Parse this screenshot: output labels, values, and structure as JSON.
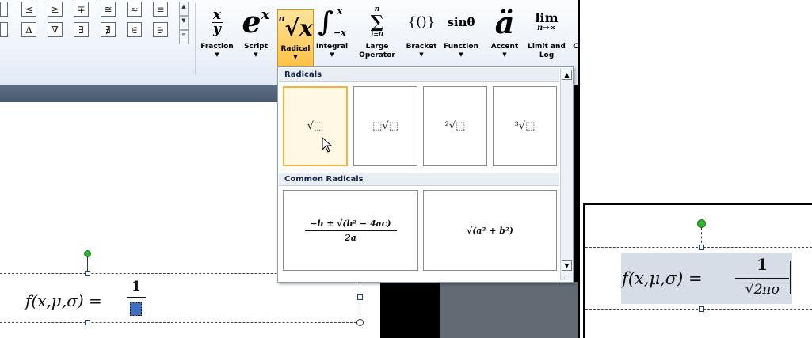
{
  "ribbon": {
    "symbols_row1": [
      "≤",
      "≥",
      "∓",
      "≅",
      "≈",
      "≡"
    ],
    "symbols_row2": [
      "Δ",
      "∇",
      "∃",
      "∄",
      "∈",
      "∋"
    ],
    "tools": [
      {
        "label": "Fraction",
        "icon": "fraction-icon"
      },
      {
        "label": "Script",
        "icon": "script-icon"
      },
      {
        "label": "Radical",
        "icon": "radical-icon"
      },
      {
        "label": "Integral",
        "icon": "integral-icon"
      },
      {
        "label": "Large\nOperator",
        "icon": "large-operator-icon"
      },
      {
        "label": "Bracket",
        "icon": "bracket-icon"
      },
      {
        "label": "Function",
        "icon": "function-icon"
      },
      {
        "label": "Accent",
        "icon": "accent-icon"
      },
      {
        "label": "Limit and\nLog",
        "icon": "limit-icon"
      }
    ],
    "fraction_glyph": {
      "num": "x",
      "den": "y"
    },
    "script_glyph": "e",
    "script_sup": "x",
    "radical_glyph": "√x",
    "radical_index": "n",
    "integral_glyph": "∫",
    "integral_upper": "x",
    "integral_lower": "−x",
    "large_op_glyph": "∑",
    "large_op_upper": "n",
    "large_op_lower": "i=0",
    "bracket_glyph": "{()}",
    "function_glyph": "sinθ",
    "accent_glyph": "ä",
    "limit_glyph": "lim",
    "limit_sub": "n→∞",
    "cut_label": "C"
  },
  "dropdown": {
    "section1": "Radicals",
    "section2": "Common Radicals",
    "radicals": [
      "√⬚",
      "⬚√⬚",
      "²√⬚",
      "³√⬚"
    ],
    "common": [
      {
        "num": "−b ± √(b² − 4ac)",
        "den": "2a"
      },
      {
        "expr": "√(a² + b²)"
      }
    ]
  },
  "document": {
    "equation_lhs": "f(x,μ,σ) =",
    "numerator": "1"
  },
  "inset": {
    "equation_lhs": "f(x,μ,σ) =",
    "numerator": "1",
    "denominator": "√2πσ"
  },
  "colors": {
    "accent": "#f2b23b",
    "handle_green": "#2fb82f",
    "handle_blue": "#1b3c8a",
    "selection": "#d6dde6"
  }
}
